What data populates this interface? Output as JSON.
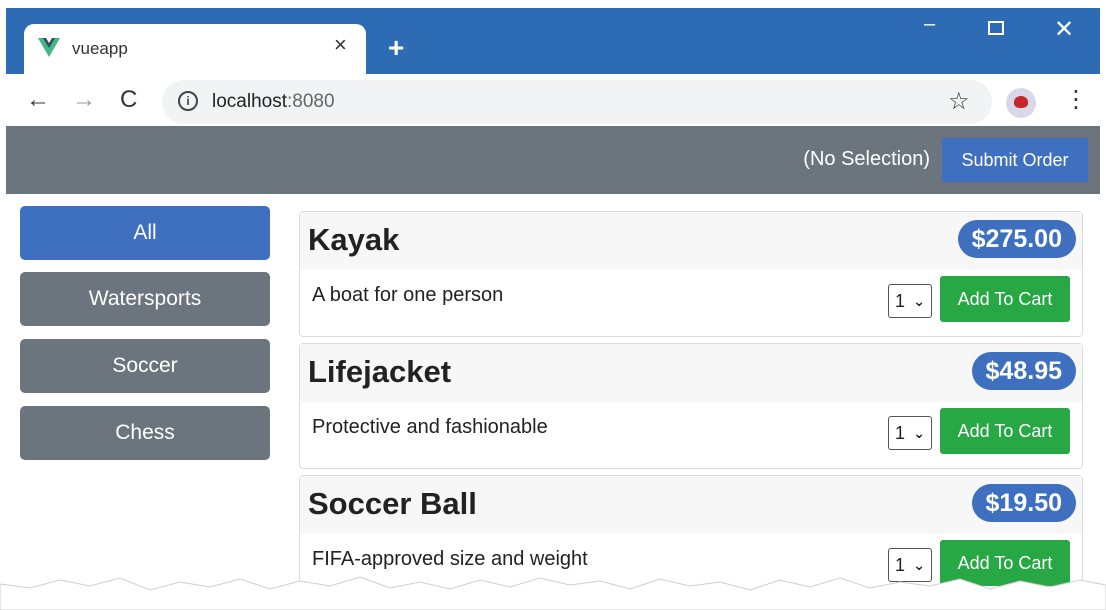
{
  "browser": {
    "tab_title": "vueapp",
    "tab_close": "×",
    "new_tab": "+",
    "minimize": "–",
    "close": "✕",
    "nav_back": "←",
    "nav_forward": "→",
    "nav_reload": "C",
    "info": "i",
    "url_host": "localhost",
    "url_port": ":8080",
    "bookmark": "☆",
    "menu": "⋮",
    "logo_color": "#41b883",
    "icons": [
      "vue-logo-icon",
      "back-icon",
      "forward-icon",
      "reload-icon",
      "info-icon",
      "star-icon",
      "profile-avatar",
      "menu-icon"
    ]
  },
  "header": {
    "selection": "(No Selection)",
    "submit_label": "Submit Order"
  },
  "categories": [
    {
      "label": "All",
      "active": true
    },
    {
      "label": "Watersports",
      "active": false
    },
    {
      "label": "Soccer",
      "active": false
    },
    {
      "label": "Chess",
      "active": false
    }
  ],
  "products": [
    {
      "name": "Kayak",
      "price": "$275.00",
      "description": "A boat for one person",
      "quantity": "1",
      "button": "Add To Cart"
    },
    {
      "name": "Lifejacket",
      "price": "$48.95",
      "description": "Protective and fashionable",
      "quantity": "1",
      "button": "Add To Cart"
    },
    {
      "name": "Soccer Ball",
      "price": "$19.50",
      "description": "FIFA-approved size and weight",
      "quantity": "1",
      "button": "Add To Cart"
    }
  ],
  "colors": {
    "titlebar": "#2d6cb5",
    "header": "#6c757d",
    "primary": "#3f6fbf",
    "success": "#28a745"
  }
}
